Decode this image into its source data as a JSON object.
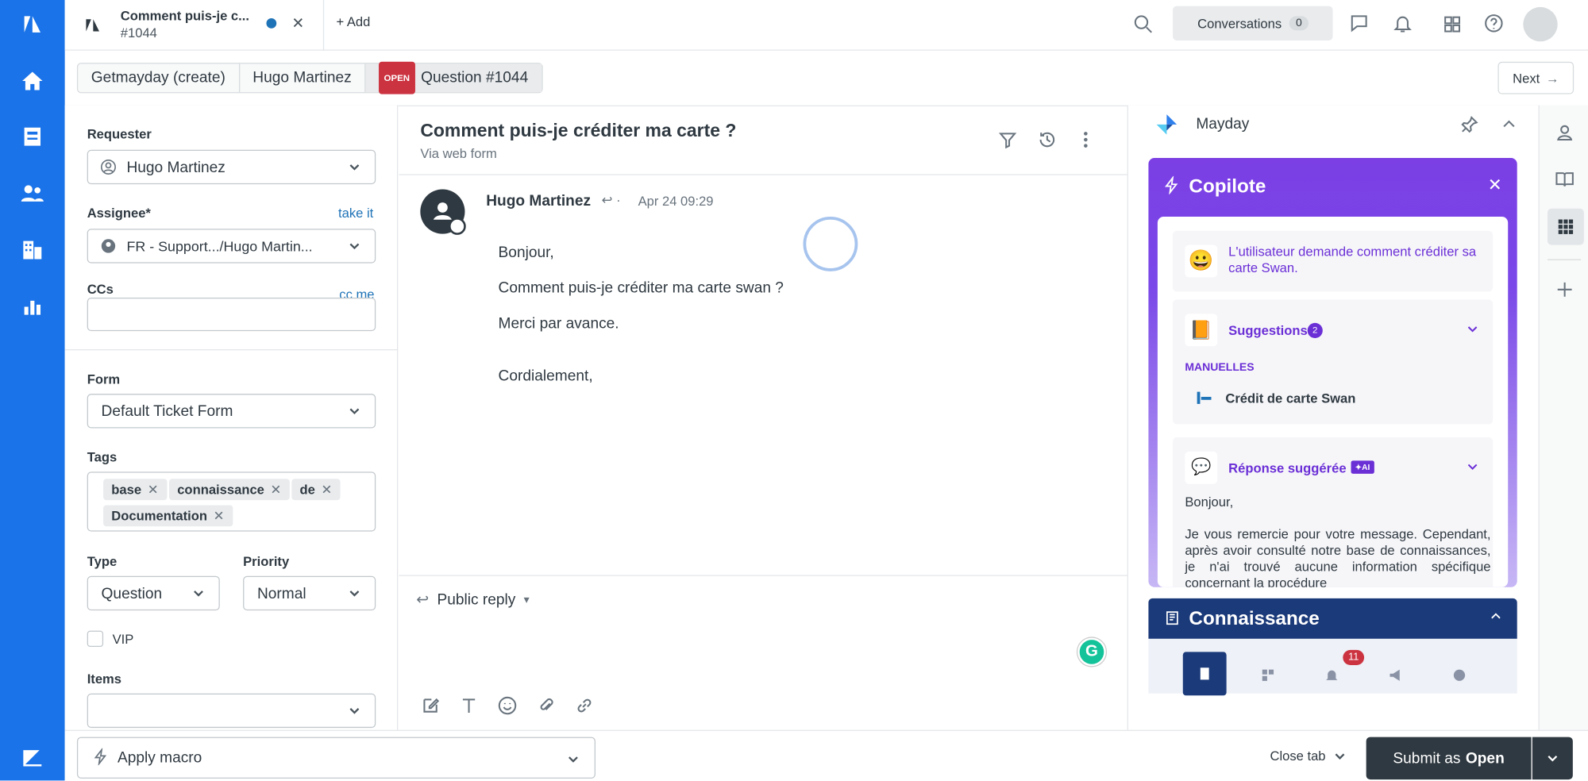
{
  "tab": {
    "title": "Comment puis-je c...",
    "number": "#1044"
  },
  "topbar": {
    "add": "Add",
    "conversations": "Conversations",
    "conv_count": "0"
  },
  "breadcrumbs": {
    "org": "Getmayday (create)",
    "user": "Hugo Martinez",
    "status": "OPEN",
    "ticket": "Question #1044"
  },
  "next": "Next",
  "left": {
    "requester_label": "Requester",
    "requester": "Hugo Martinez",
    "assignee_label": "Assignee*",
    "take_it": "take it",
    "assignee": "FR - Support.../Hugo Martin...",
    "ccs_label": "CCs",
    "cc_me": "cc me",
    "form_label": "Form",
    "form": "Default Ticket Form",
    "tags_label": "Tags",
    "tags": [
      "base",
      "connaissance",
      "de",
      "Documentation"
    ],
    "type_label": "Type",
    "type": "Question",
    "priority_label": "Priority",
    "priority": "Normal",
    "vip": "VIP",
    "items_label": "Items"
  },
  "ticket": {
    "subject": "Comment puis-je créditer ma carte ?",
    "via": "Via web form",
    "author": "Hugo Martinez",
    "date": "Apr 24 09:29",
    "body": [
      "Bonjour,",
      "Comment puis-je créditer ma carte swan ?",
      "Merci par avance.",
      "Cordialement,"
    ]
  },
  "reply": {
    "mode": "Public reply"
  },
  "mayday": {
    "title": "Mayday",
    "copilote": "Copilote",
    "summary": "L'utilisateur demande comment créditer sa carte Swan.",
    "suggestions": "Suggestions",
    "sugg_count": "2",
    "manuelles": "MANUELLES",
    "article": "Crédit de carte Swan",
    "reponse": "Réponse suggérée",
    "ai": "AI",
    "answer_1": "Bonjour,",
    "answer_2": "Je vous remercie pour votre message. Cependant, après avoir consulté notre base de connaissances, je n'ai trouvé aucune information spécifique concernant la procédure",
    "connaissance": "Connaissance",
    "notif_count": "11"
  },
  "bottom": {
    "macro": "Apply macro",
    "close_tab": "Close tab",
    "submit": "Submit as",
    "submit_status": "Open"
  }
}
